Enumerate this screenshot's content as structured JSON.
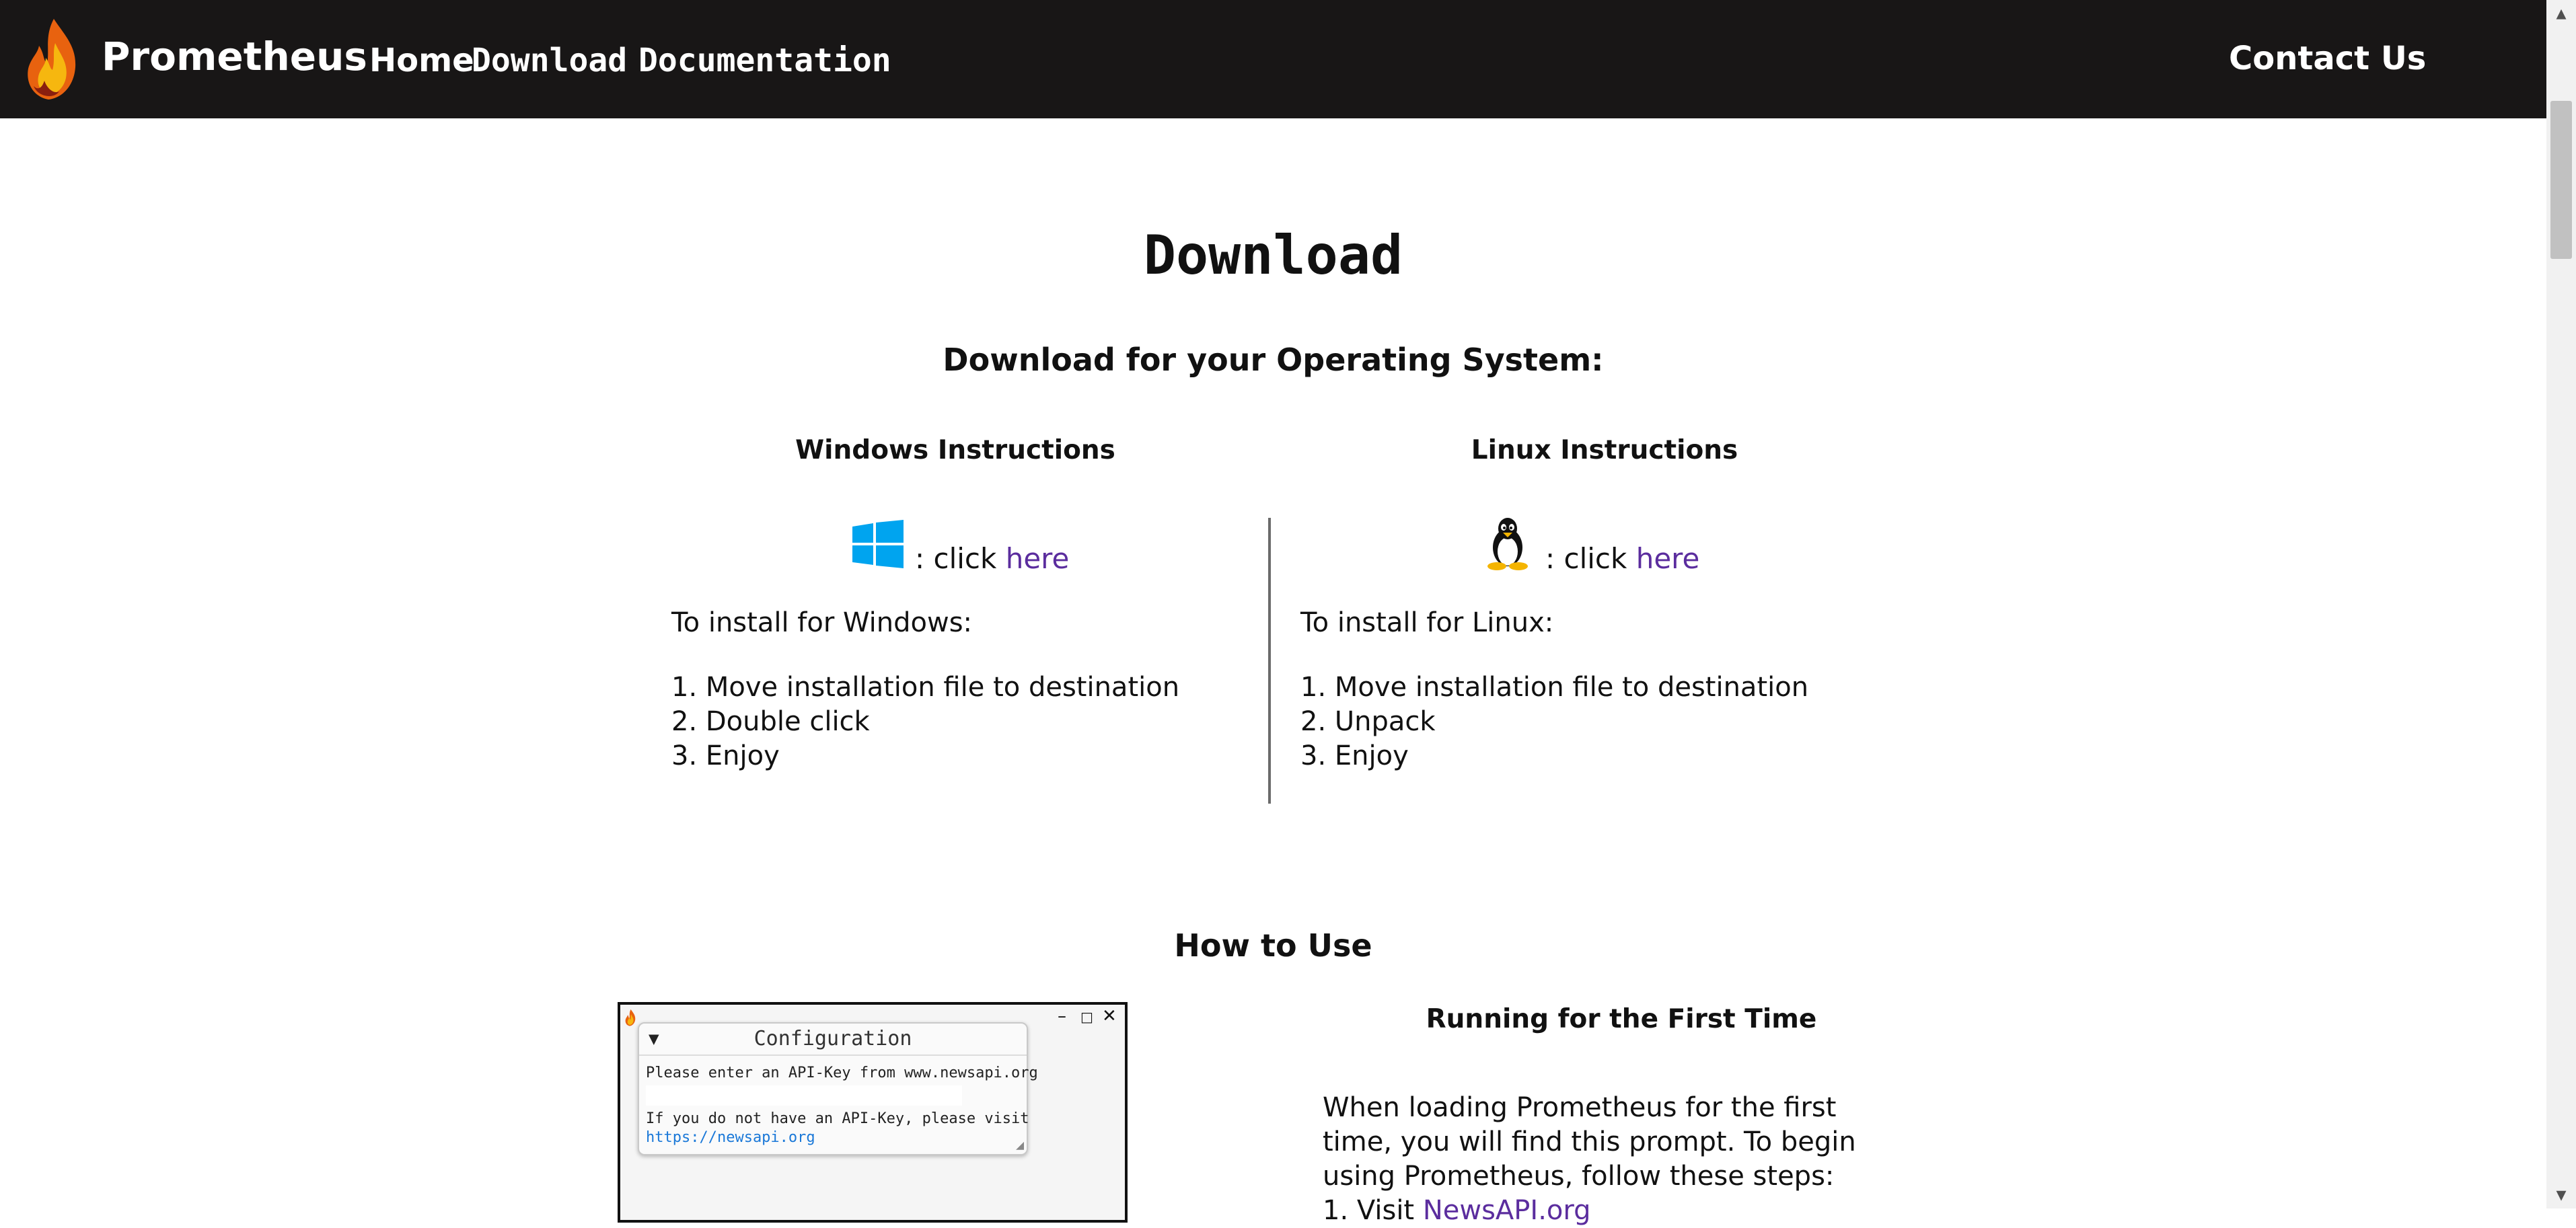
{
  "navbar": {
    "brand": "Prometheus",
    "links": {
      "home": "Home",
      "download": "Download",
      "documentation": "Documentation",
      "contact": "Contact Us"
    }
  },
  "page": {
    "title": "Download",
    "os_heading": "Download for your Operating System:"
  },
  "windows": {
    "heading": "Windows Instructions",
    "click_prefix": ": click ",
    "link": "here",
    "intro": "To install for Windows:",
    "steps": [
      "1. Move installation file to destination",
      "2. Double click",
      "3. Enjoy"
    ]
  },
  "linux": {
    "heading": "Linux Instructions",
    "click_prefix": ": click ",
    "link": "here",
    "intro": "To install for Linux:",
    "steps": [
      "1. Move installation file to destination",
      "2. Unpack",
      "3. Enjoy"
    ]
  },
  "how_to_use": {
    "heading": "How to Use",
    "first_time_heading": "Running for the First Time",
    "first_time_text": "When loading Prometheus for the first time, you will find this prompt.  To begin using Prometheus, follow these steps:",
    "step1_prefix": "1. Visit ",
    "step1_link": "NewsAPI.org"
  },
  "config_dialog": {
    "title": "Configuration",
    "line1": "Please enter an API-Key from www.newsapi.org",
    "line2": "If you do not have an API-Key, please visit",
    "link": "https://newsapi.org"
  },
  "colors": {
    "navbar_bg": "#181616",
    "link": "#5b2d9e",
    "windows_blue": "#00a4ef"
  }
}
